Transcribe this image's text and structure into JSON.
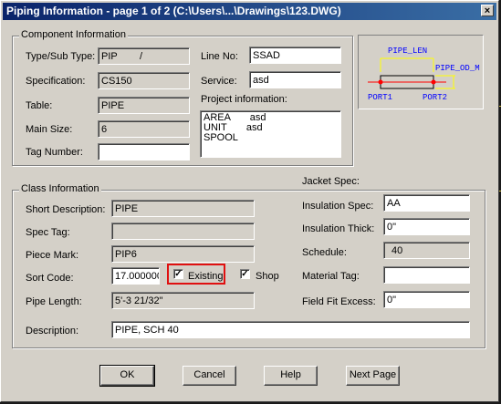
{
  "window": {
    "title": "Piping Information - page 1 of 2 (C:\\Users\\...\\Drawings\\123.DWG)",
    "close_glyph": "×"
  },
  "component": {
    "group_title": "Component Information",
    "type_label": "Type/Sub Type:",
    "type_value": "PIP        /",
    "spec_label": "Specification:",
    "spec_value": "CS150",
    "table_label": "Table:",
    "table_value": "PIPE",
    "main_size_label": "Main Size:",
    "main_size_value": "6",
    "tag_number_label": "Tag Number:",
    "tag_number_value": "",
    "line_no_label": "Line No:",
    "line_no_value": "SSAD",
    "service_label": "Service:",
    "service_value": "asd",
    "project_info_label": "Project information:",
    "project_info_value": "AREA       asd\nUNIT       asd\nSPOOL"
  },
  "preview": {
    "pipe_len": "PIPE_LEN",
    "pipe_od": "PIPE_OD_M",
    "port1": "PORT1",
    "port2": "PORT2",
    "colors": {
      "pipe": "#000000",
      "dim": "#ffff00",
      "port_text": "#0000ff",
      "port_dot": "#ff0000",
      "label": "#0000ff"
    }
  },
  "class": {
    "group_title": "Class Information",
    "short_desc_label": "Short Description:",
    "short_desc_value": "PIPE",
    "spec_tag_label": "Spec Tag:",
    "spec_tag_value": "",
    "piece_mark_label": "Piece Mark:",
    "piece_mark_value": "PIP6",
    "sort_code_label": "Sort Code:",
    "sort_code_value": "17.000000",
    "existing_label": "Existing",
    "existing_checked": true,
    "shop_label": "Shop",
    "shop_checked": true,
    "pipe_length_label": "Pipe Length:",
    "pipe_length_value": "5'-3 21/32\"",
    "description_label": "Description:",
    "description_value": "PIPE, SCH 40",
    "jacket_spec_label": "Jacket Spec:",
    "insulation_spec_label": "Insulation Spec:",
    "insulation_spec_value": "AA",
    "insulation_thick_label": "Insulation Thick:",
    "insulation_thick_value": "0\"",
    "schedule_label": "Schedule:",
    "schedule_value": "40",
    "material_tag_label": "Material Tag:",
    "material_tag_value": "",
    "field_fit_label": "Field Fit Excess:",
    "field_fit_value": "0\"",
    "check_glyph": "✓"
  },
  "buttons": {
    "ok": "OK",
    "cancel": "Cancel",
    "help": "Help",
    "next_page": "Next Page"
  },
  "highlight_color": "#e01010"
}
